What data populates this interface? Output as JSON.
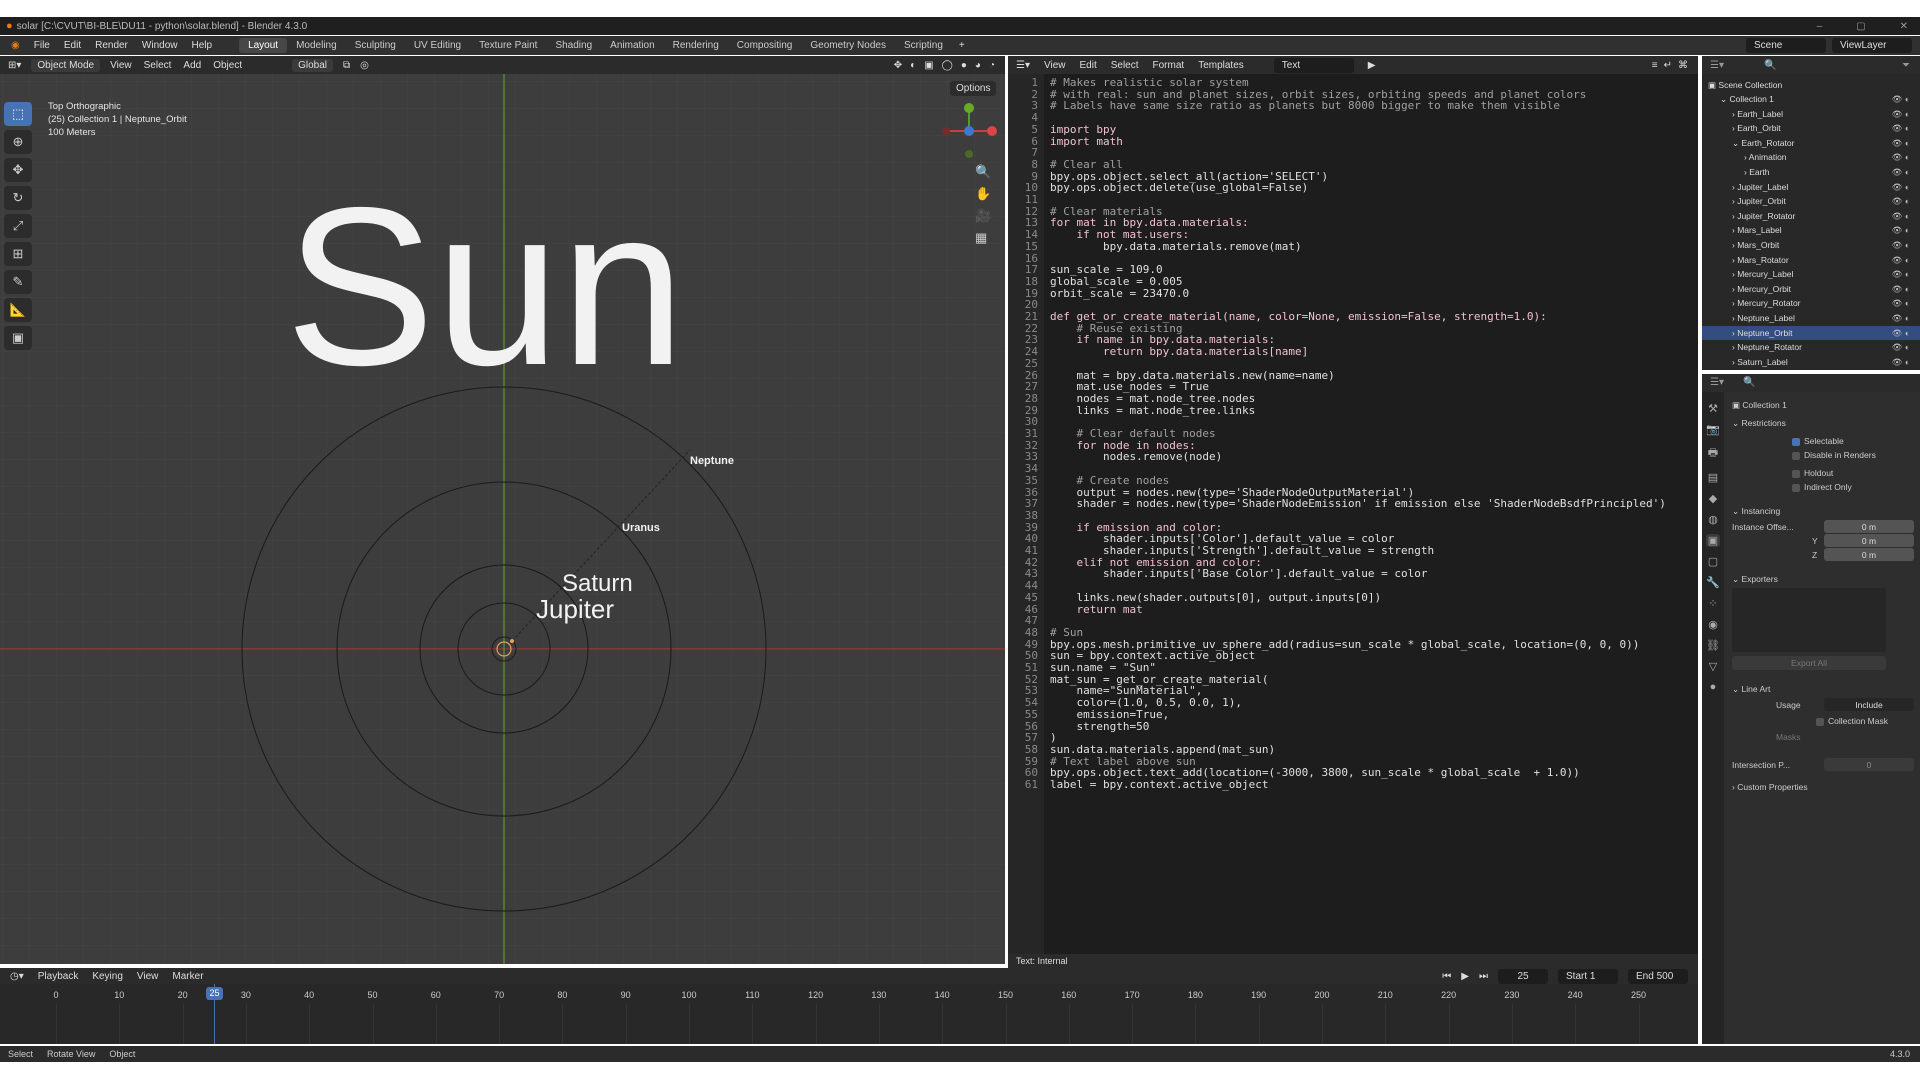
{
  "window": {
    "title": "solar [C:\\CVUT\\BI-BLE\\DU11 - python\\solar.blend] - Blender 4.3.0"
  },
  "menu": [
    "File",
    "Edit",
    "Render",
    "Window",
    "Help"
  ],
  "workspaces": [
    "Layout",
    "Modeling",
    "Sculpting",
    "UV Editing",
    "Texture Paint",
    "Shading",
    "Animation",
    "Rendering",
    "Compositing",
    "Geometry Nodes",
    "Scripting"
  ],
  "scene": "Scene",
  "view_layer": "ViewLayer",
  "viewport": {
    "mode": "Object Mode",
    "menus": [
      "View",
      "Select",
      "Add",
      "Object"
    ],
    "orientation": "Global",
    "options": "Options",
    "view_name": "Top Orthographic",
    "collection_info": "(25) Collection 1 | Neptune_Orbit",
    "scale": "100 Meters",
    "labels": {
      "sun": "Sun",
      "saturn": "Saturn",
      "jupiter": "Jupiter",
      "uranus": "Uranus",
      "neptune": "Neptune"
    },
    "colors": {
      "x_axis": "#a03030",
      "y_axis": "#5a9a2a"
    }
  },
  "text_editor": {
    "menus": [
      "View",
      "Edit",
      "Select",
      "Format",
      "Templates"
    ],
    "datablock": "Text",
    "footer": "Text: Internal",
    "lines": [
      "# Makes realistic solar system",
      "# with real: sun and planet sizes, orbit sizes, orbiting speeds and planet colors",
      "# Labels have same size ratio as planets but 8000 bigger to make them visible",
      "",
      "import bpy",
      "import math",
      "",
      "# Clear all",
      "bpy.ops.object.select_all(action='SELECT')",
      "bpy.ops.object.delete(use_global=False)",
      "",
      "# Clear materials",
      "for mat in bpy.data.materials:",
      "    if not mat.users:",
      "        bpy.data.materials.remove(mat)",
      "",
      "sun_scale = 109.0",
      "global_scale = 0.005",
      "orbit_scale = 23470.0",
      "",
      "def get_or_create_material(name, color=None, emission=False, strength=1.0):",
      "    # Reuse existing",
      "    if name in bpy.data.materials:",
      "        return bpy.data.materials[name]",
      "",
      "    mat = bpy.data.materials.new(name=name)",
      "    mat.use_nodes = True",
      "    nodes = mat.node_tree.nodes",
      "    links = mat.node_tree.links",
      "",
      "    # Clear default nodes",
      "    for node in nodes:",
      "        nodes.remove(node)",
      "",
      "    # Create nodes",
      "    output = nodes.new(type='ShaderNodeOutputMaterial')",
      "    shader = nodes.new(type='ShaderNodeEmission' if emission else 'ShaderNodeBsdfPrincipled')",
      "",
      "    if emission and color:",
      "        shader.inputs['Color'].default_value = color",
      "        shader.inputs['Strength'].default_value = strength",
      "    elif not emission and color:",
      "        shader.inputs['Base Color'].default_value = color",
      "",
      "    links.new(shader.outputs[0], output.inputs[0])",
      "    return mat",
      "",
      "# Sun",
      "bpy.ops.mesh.primitive_uv_sphere_add(radius=sun_scale * global_scale, location=(0, 0, 0))",
      "sun = bpy.context.active_object",
      "sun.name = \"Sun\"",
      "mat_sun = get_or_create_material(",
      "    name=\"SunMaterial\",",
      "    color=(1.0, 0.5, 0.0, 1),",
      "    emission=True,",
      "    strength=50",
      ")",
      "sun.data.materials.append(mat_sun)",
      "# Text label above sun",
      "bpy.ops.object.text_add(location=(-3000, 3800, sun_scale * global_scale  + 1.0))",
      "label = bpy.context.active_object"
    ]
  },
  "outliner": {
    "root": "Scene Collection",
    "items": [
      {
        "name": "Collection 1",
        "indent": 1,
        "open": true
      },
      {
        "name": "Earth_Label",
        "indent": 2
      },
      {
        "name": "Earth_Orbit",
        "indent": 2
      },
      {
        "name": "Earth_Rotator",
        "indent": 2,
        "open": true
      },
      {
        "name": "Animation",
        "indent": 3
      },
      {
        "name": "Earth",
        "indent": 3
      },
      {
        "name": "Jupiter_Label",
        "indent": 2
      },
      {
        "name": "Jupiter_Orbit",
        "indent": 2
      },
      {
        "name": "Jupiter_Rotator",
        "indent": 2
      },
      {
        "name": "Mars_Label",
        "indent": 2
      },
      {
        "name": "Mars_Orbit",
        "indent": 2
      },
      {
        "name": "Mars_Rotator",
        "indent": 2
      },
      {
        "name": "Mercury_Label",
        "indent": 2
      },
      {
        "name": "Mercury_Orbit",
        "indent": 2
      },
      {
        "name": "Mercury_Rotator",
        "indent": 2
      },
      {
        "name": "Neptune_Label",
        "indent": 2
      },
      {
        "name": "Neptune_Orbit",
        "indent": 2
      },
      {
        "name": "Neptune_Rotator",
        "indent": 2
      },
      {
        "name": "Saturn_Label",
        "indent": 2
      }
    ]
  },
  "properties": {
    "title": "Collection 1",
    "sections": {
      "restrictions": "Restrictions",
      "instancing": "Instancing",
      "exporters": "Exporters",
      "line_art": "Line Art",
      "custom": "Custom Properties"
    },
    "selectable": "Selectable",
    "disable_renders": "Disable in Renders",
    "holdout": "Holdout",
    "indirect_only": "Indirect Only",
    "instance_offset_label": "Instance Offse...",
    "offset_x": "0 m",
    "y_label": "Y",
    "offset_y": "0 m",
    "z_label": "Z",
    "offset_z": "0 m",
    "export_all": "Export All",
    "usage_label": "Usage",
    "usage": "Include",
    "collection_mask": "Collection Mask",
    "masks": "Masks",
    "intersection": "Intersection P...",
    "intersection_val": "0"
  },
  "timeline": {
    "menus": [
      "Playback",
      "Keying",
      "View",
      "Marker"
    ],
    "current_frame": "25",
    "start_label": "Start",
    "start": "1",
    "end_label": "End",
    "end": "500",
    "ticks": [
      "0",
      "10",
      "20",
      "30",
      "40",
      "50",
      "60",
      "70",
      "80",
      "90",
      "100",
      "110",
      "120",
      "130",
      "140",
      "150",
      "160",
      "170",
      "180",
      "190",
      "200",
      "210",
      "220",
      "230",
      "240",
      "250"
    ]
  },
  "statusbar": {
    "items": [
      "Select",
      "Rotate View",
      "Object"
    ],
    "version": "4.3.0"
  }
}
